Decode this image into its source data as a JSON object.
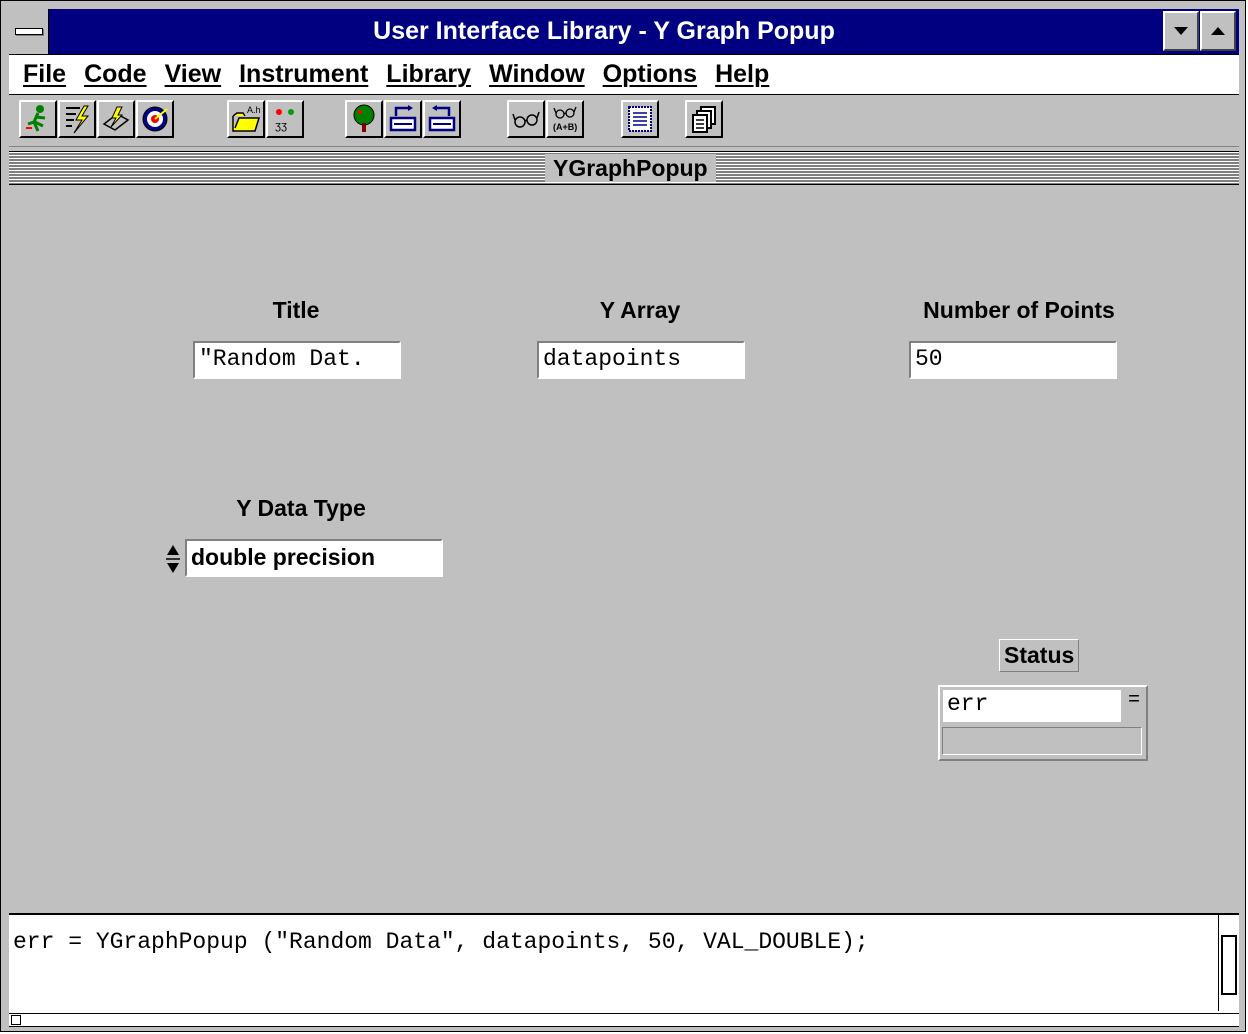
{
  "window": {
    "title": "User Interface Library - Y Graph Popup"
  },
  "menu": {
    "items": [
      "File",
      "Code",
      "View",
      "Instrument",
      "Library",
      "Window",
      "Options",
      "Help"
    ]
  },
  "toolbar": {
    "icons": [
      "run-icon",
      "lightning-icon",
      "step-icon",
      "target-icon",
      "open-folder-icon",
      "find-icon",
      "tree-icon",
      "insert-function-icon",
      "set-target-icon",
      "glasses-icon",
      "glasses-ab-icon",
      "panel-icon",
      "copy-icon"
    ]
  },
  "panel": {
    "name": "YGraphPopup"
  },
  "fields": {
    "title": {
      "label": "Title",
      "value": "\"Random Dat."
    },
    "y_array": {
      "label": "Y Array",
      "value": "datapoints"
    },
    "num_points": {
      "label": "Number of Points",
      "value": "50"
    },
    "y_data_type": {
      "label": "Y Data Type",
      "value": "double precision"
    },
    "status": {
      "label": "Status",
      "value": "err",
      "suffix": "="
    }
  },
  "code": {
    "line": "err = YGraphPopup (\"Random Data\", datapoints, 50, VAL_DOUBLE);"
  },
  "colors": {
    "title_bar": "#000080",
    "face": "#c0c0c0"
  }
}
